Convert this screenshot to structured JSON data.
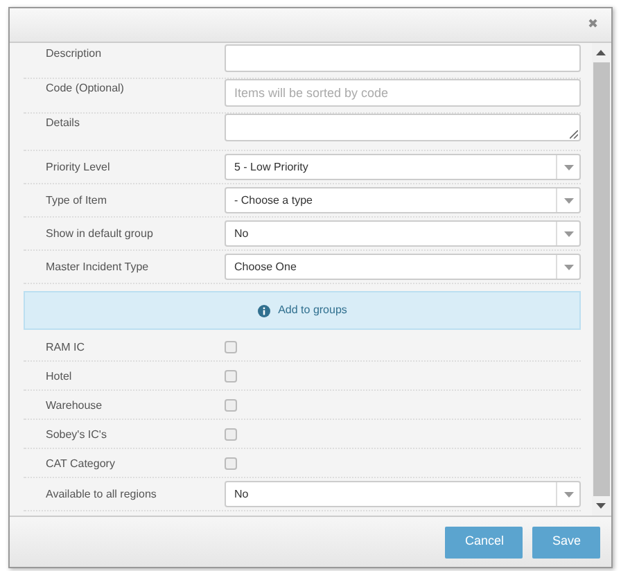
{
  "dialog": {
    "close": "✖"
  },
  "fields": [
    {
      "kind": "text",
      "label": "Description"
    },
    {
      "kind": "text",
      "label": "Code (Optional)",
      "placeholder": "Items will be sorted by code"
    },
    {
      "kind": "textarea",
      "label": "Details"
    },
    {
      "kind": "select",
      "label": "Priority Level",
      "value": "5 - Low Priority"
    },
    {
      "kind": "select",
      "label": "Type of Item",
      "value": "- Choose a type"
    },
    {
      "kind": "select",
      "label": "Show in default group",
      "value": "No"
    },
    {
      "kind": "select",
      "label": "Master Incident Type",
      "value": "Choose One"
    },
    {
      "kind": "info",
      "label": "Add to groups"
    },
    {
      "kind": "checkbox",
      "label": "RAM IC",
      "checked": false
    },
    {
      "kind": "checkbox",
      "label": "Hotel",
      "checked": false
    },
    {
      "kind": "checkbox",
      "label": "Warehouse",
      "checked": false
    },
    {
      "kind": "checkbox",
      "label": "Sobey's IC's",
      "checked": false
    },
    {
      "kind": "checkbox",
      "label": "CAT Category",
      "checked": false
    },
    {
      "kind": "select",
      "label": "Available to all regions",
      "value": "No"
    }
  ],
  "buttons": [
    {
      "label": "Cancel"
    },
    {
      "label": "Save"
    }
  ]
}
